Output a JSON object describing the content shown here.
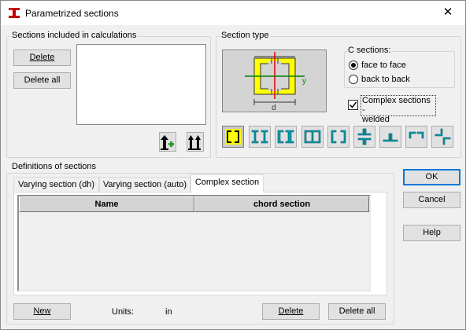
{
  "window": {
    "title": "Parametrized sections",
    "close_glyph": "✕"
  },
  "sections_included": {
    "group_label": "Sections included in calculations",
    "delete_label": "Delete",
    "delete_all_label": "Delete all",
    "list_items": []
  },
  "section_type": {
    "group_label": "Section type",
    "preview_labels": {
      "axis": "y",
      "dim": "d"
    },
    "c_sections": {
      "label": "C sections:",
      "options": [
        "face to face",
        "back to back"
      ],
      "selected": "face to face"
    },
    "complex_welded": {
      "label_line1": "Complex sections -",
      "label_line2": "welded",
      "checked": true
    },
    "types": [
      "c-face-to-face-icon",
      "i-double-icon",
      "c-back-to-back-icon",
      "c-channel-mixed-icon",
      "c-open-icon",
      "cross-angles-icon",
      "t-double-icon",
      "angle-face-icon",
      "angle-zig-icon"
    ],
    "selected_index": 0
  },
  "definitions": {
    "group_label": "Definitions of sections",
    "tabs": [
      "Varying section (dh)",
      "Varying section (auto)",
      "Complex section"
    ],
    "active_tab": 2,
    "columns": [
      "Name",
      "chord section"
    ],
    "rows": [],
    "new_label": "New",
    "units_label": "Units:",
    "units_value": "in",
    "delete_label": "Delete",
    "delete_all_label": "Delete all"
  },
  "dialog_buttons": {
    "ok": "OK",
    "cancel": "Cancel",
    "help": "Help"
  },
  "colors": {
    "accent": "#0078d7",
    "section_fill": "#ffff00",
    "axis_red": "#e00000",
    "axis_green": "#008000",
    "icon_cyan": "#00a0b0"
  }
}
